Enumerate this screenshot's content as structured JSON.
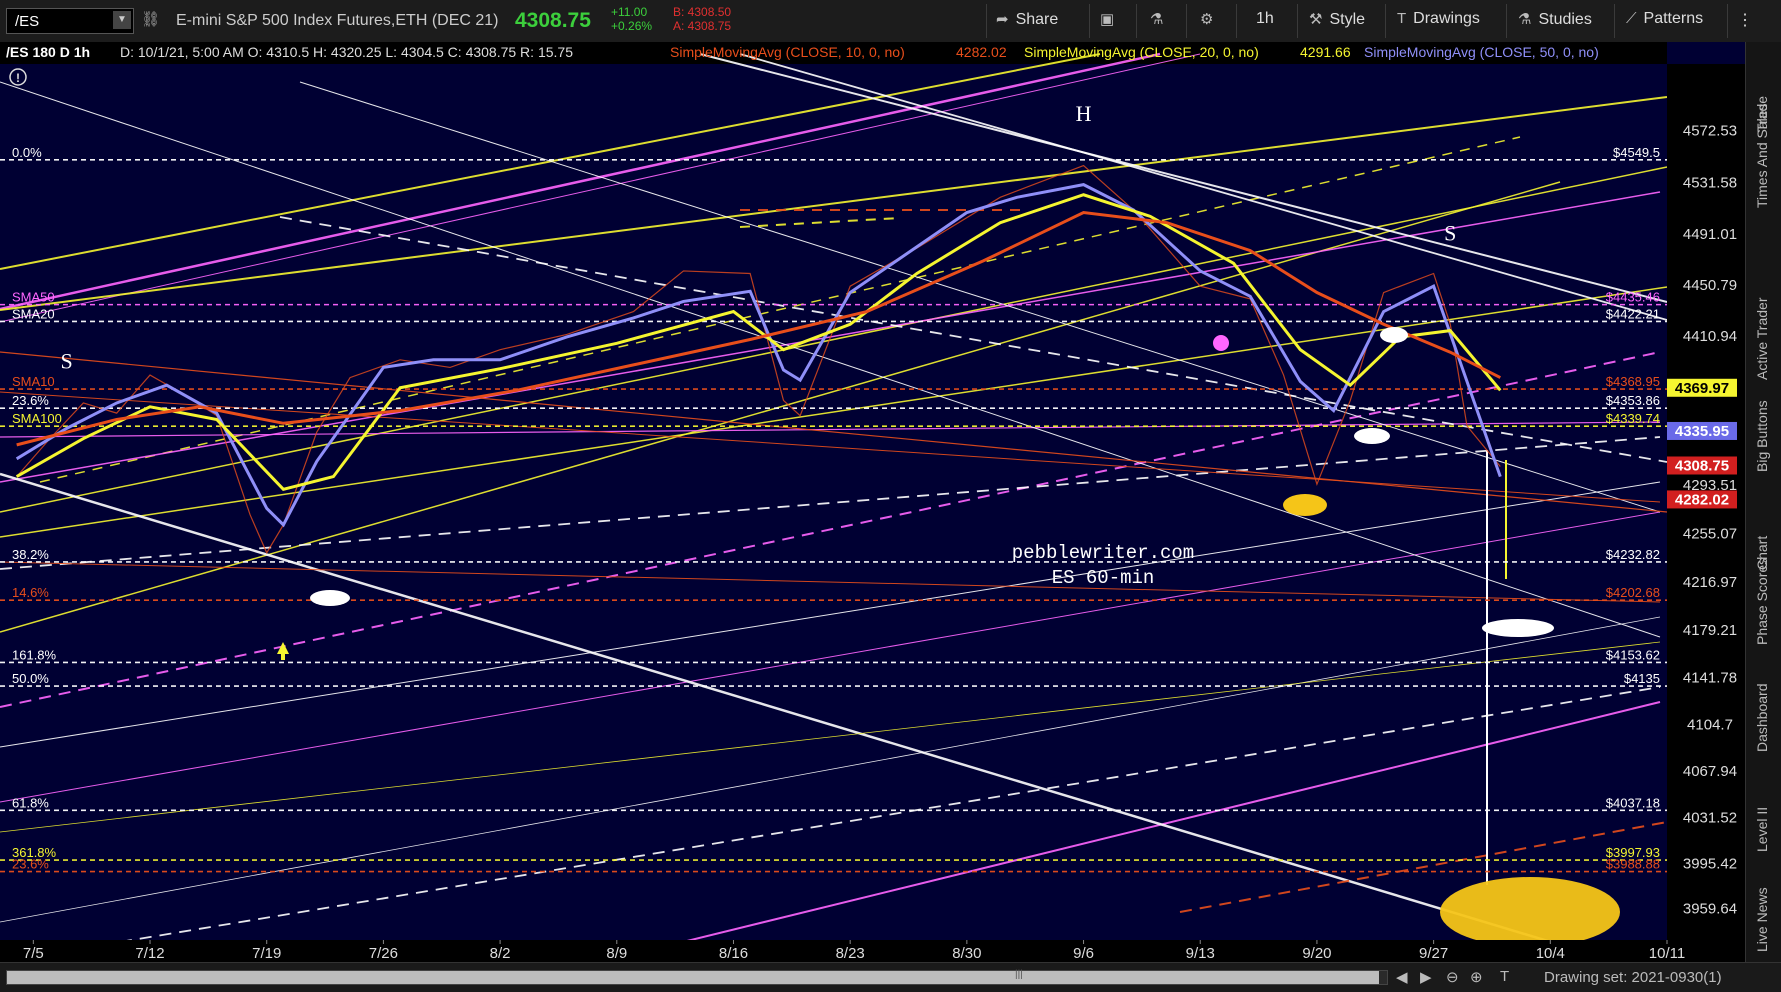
{
  "toolbar": {
    "symbol": "/ES",
    "description": "E-mini S&P 500 Index Futures,ETH (DEC 21)",
    "last": "4308.75",
    "change": "+11.00",
    "change_pct": "+0.26%",
    "bid": "B: 4308.50",
    "ask": "A: 4308.75",
    "share": "Share",
    "interval": "1h",
    "style": "Style",
    "drawings": "Drawings",
    "studies": "Studies",
    "patterns": "Patterns"
  },
  "header": {
    "title": "/ES 180 D 1h",
    "bar_info": "D: 10/1/21, 5:00 AM  O: 4310.5  H: 4320.25  L: 4304.5  C: 4308.75  R: 15.75",
    "study1": "SimpleMovingAvg (CLOSE, 10, 0, no)",
    "study1_val": "4282.02",
    "study2": "SimpleMovingAvg (CLOSE, 20, 0, no)",
    "study2_val": "4291.66",
    "study3": "SimpleMovingAvg (CLOSE, 50, 0, no)"
  },
  "rail": [
    "Trade",
    "Times And Sales",
    "Active Trader",
    "Big Buttons",
    "Chart",
    "Phase Scores",
    "Dashboard",
    "Level II",
    "Live News"
  ],
  "bottom": {
    "drawing_set": "Drawing set: 2021-0930(1)"
  },
  "colors": {
    "background": "#000033",
    "sma10": "#e84e1b",
    "sma20": "#f5f530",
    "sma50": "#8f8ff8",
    "sma100_label": "#f5f530",
    "fib": "#ffffff",
    "magenta": "#ff66ff",
    "target": "#f5c518"
  },
  "chart_data": {
    "type": "line",
    "title": "/ES 180 D 1h",
    "watermark": [
      "pebblewriter.com",
      "ES 60-min"
    ],
    "x_ticks": [
      "7/5",
      "7/12",
      "7/19",
      "7/26",
      "8/2",
      "8/9",
      "8/16",
      "8/23",
      "8/30",
      "9/6",
      "9/13",
      "9/20",
      "9/27",
      "10/4",
      "10/11"
    ],
    "y_ticks": [
      "4572.53",
      "4531.58",
      "4491.01",
      "4450.79",
      "4410.94",
      "4369.97",
      "4335.95",
      "4293.51",
      "4255.07",
      "4216.97",
      "4179.21",
      "4141.78",
      "4104.7",
      "4067.94",
      "4031.52",
      "3995.42",
      "3959.64"
    ],
    "ylim": [
      3935,
      4625
    ],
    "x_domain": [
      "2021-07-03",
      "2021-10-11"
    ],
    "price_tags": [
      {
        "text": "4369.97",
        "value": 4369.97,
        "color": "#f5f530",
        "text_color": "#000"
      },
      {
        "text": "4335.95",
        "value": 4335.95,
        "color": "#6a6ae8",
        "text_color": "#fff"
      },
      {
        "text": "4308.75",
        "value": 4308.75,
        "color": "#d21f1f",
        "text_color": "#fff"
      },
      {
        "text": "4282.02",
        "value": 4282.02,
        "color": "#d21f1f",
        "text_color": "#fff"
      }
    ],
    "level_labels": [
      {
        "left": "0.0%",
        "right": "$4549.5",
        "value": 4549.5,
        "color": "#ffffff"
      },
      {
        "left": "SMA50",
        "right": "$4435.46",
        "value": 4435.46,
        "color": "#ff66ff"
      },
      {
        "left": "SMA20",
        "right": "$4422.21",
        "value": 4422.21,
        "color": "#ffffff"
      },
      {
        "left": "SMA10",
        "right": "$4368.95",
        "value": 4368.95,
        "color": "#e84e1b"
      },
      {
        "left": "23.6%",
        "right": "$4353.86",
        "value": 4353.86,
        "color": "#ffffff"
      },
      {
        "left": "SMA100",
        "right": "$4339.74",
        "value": 4339.74,
        "color": "#f5f530"
      },
      {
        "left": "38.2%",
        "right": "$4232.82",
        "value": 4232.82,
        "color": "#ffffff"
      },
      {
        "left": "14.6%",
        "right": "$4202.68",
        "value": 4202.68,
        "color": "#e84e1b"
      },
      {
        "left": "161.8%",
        "right": "$4153.62",
        "value": 4153.62,
        "color": "#ffffff"
      },
      {
        "left": "50.0%",
        "right": "$4135",
        "value": 4135,
        "color": "#ffffff"
      },
      {
        "left": "61.8%",
        "right": "$4037.18",
        "value": 4037.18,
        "color": "#ffffff"
      },
      {
        "left": "361.8%",
        "right": "$3997.93",
        "value": 3997.93,
        "color": "#f5f530"
      },
      {
        "left": "23.6%",
        "right": "$3988.88",
        "value": 3988.88,
        "color": "#e84e1b"
      }
    ],
    "annotations": [
      {
        "text": "H",
        "x": "2021-09-06",
        "y": 4580
      },
      {
        "text": "S",
        "x": "2021-07-07",
        "y": 4385
      },
      {
        "text": "S",
        "x": "2021-09-28",
        "y": 4486
      }
    ],
    "series": [
      {
        "name": "SimpleMovingAvg (CLOSE, 10, 0, no)",
        "color": "#8f8ff8",
        "x": [
          "2021-07-04",
          "2021-07-07",
          "2021-07-10",
          "2021-07-13",
          "2021-07-16",
          "2021-07-19",
          "2021-07-20",
          "2021-07-22",
          "2021-07-26",
          "2021-07-29",
          "2021-08-02",
          "2021-08-06",
          "2021-08-10",
          "2021-08-13",
          "2021-08-17",
          "2021-08-19",
          "2021-08-20",
          "2021-08-23",
          "2021-08-26",
          "2021-08-30",
          "2021-09-02",
          "2021-09-06",
          "2021-09-09",
          "2021-09-13",
          "2021-09-16",
          "2021-09-19",
          "2021-09-21",
          "2021-09-24",
          "2021-09-27",
          "2021-09-29",
          "2021-10-01"
        ],
        "values": [
          4314,
          4338,
          4358,
          4372,
          4350,
          4275,
          4262,
          4312,
          4386,
          4392,
          4392,
          4410,
          4425,
          4438,
          4446,
          4384,
          4376,
          4445,
          4472,
          4508,
          4520,
          4530,
          4510,
          4462,
          4442,
          4375,
          4352,
          4430,
          4450,
          4375,
          4300
        ]
      },
      {
        "name": "SimpleMovingAvg (CLOSE, 20, 0, no)",
        "color": "#f5f530",
        "x": [
          "2021-07-04",
          "2021-07-08",
          "2021-07-12",
          "2021-07-16",
          "2021-07-20",
          "2021-07-23",
          "2021-07-27",
          "2021-08-02",
          "2021-08-09",
          "2021-08-16",
          "2021-08-19",
          "2021-08-23",
          "2021-08-27",
          "2021-09-01",
          "2021-09-06",
          "2021-09-10",
          "2021-09-15",
          "2021-09-19",
          "2021-09-22",
          "2021-09-25",
          "2021-09-28",
          "2021-10-01"
        ],
        "values": [
          4300,
          4330,
          4355,
          4345,
          4290,
          4300,
          4370,
          4385,
          4405,
          4430,
          4400,
          4420,
          4460,
          4500,
          4522,
          4505,
          4468,
          4400,
          4372,
          4410,
          4415,
          4368
        ]
      },
      {
        "name": "SimpleMovingAvg (CLOSE, 50, 0, no)",
        "color": "#e84e1b",
        "x": [
          "2021-07-04",
          "2021-07-10",
          "2021-07-15",
          "2021-07-20",
          "2021-07-27",
          "2021-08-03",
          "2021-08-10",
          "2021-08-17",
          "2021-08-24",
          "2021-08-31",
          "2021-09-06",
          "2021-09-11",
          "2021-09-16",
          "2021-09-20",
          "2021-09-24",
          "2021-09-28",
          "2021-10-01"
        ],
        "values": [
          4325,
          4345,
          4355,
          4342,
          4352,
          4368,
          4388,
          4408,
          4430,
          4470,
          4508,
          4500,
          4478,
          4445,
          4420,
          4398,
          4378
        ]
      }
    ],
    "price_path": {
      "x": [
        "2021-07-04",
        "2021-07-06",
        "2021-07-08",
        "2021-07-10",
        "2021-07-12",
        "2021-07-14",
        "2021-07-16",
        "2021-07-18",
        "2021-07-19",
        "2021-07-20",
        "2021-07-22",
        "2021-07-24",
        "2021-07-27",
        "2021-07-30",
        "2021-08-02",
        "2021-08-06",
        "2021-08-10",
        "2021-08-13",
        "2021-08-17",
        "2021-08-19",
        "2021-08-20",
        "2021-08-23",
        "2021-08-27",
        "2021-09-01",
        "2021-09-03",
        "2021-09-06",
        "2021-09-09",
        "2021-09-13",
        "2021-09-16",
        "2021-09-18",
        "2021-09-20",
        "2021-09-22",
        "2021-09-24",
        "2021-09-27",
        "2021-09-28",
        "2021-09-29",
        "2021-10-01"
      ],
      "values": [
        4300,
        4330,
        4358,
        4350,
        4380,
        4365,
        4348,
        4270,
        4240,
        4262,
        4335,
        4378,
        4392,
        4386,
        4400,
        4412,
        4430,
        4462,
        4460,
        4360,
        4348,
        4450,
        4480,
        4520,
        4530,
        4545,
        4510,
        4450,
        4440,
        4380,
        4294,
        4360,
        4445,
        4460,
        4420,
        4340,
        4308
      ]
    }
  }
}
